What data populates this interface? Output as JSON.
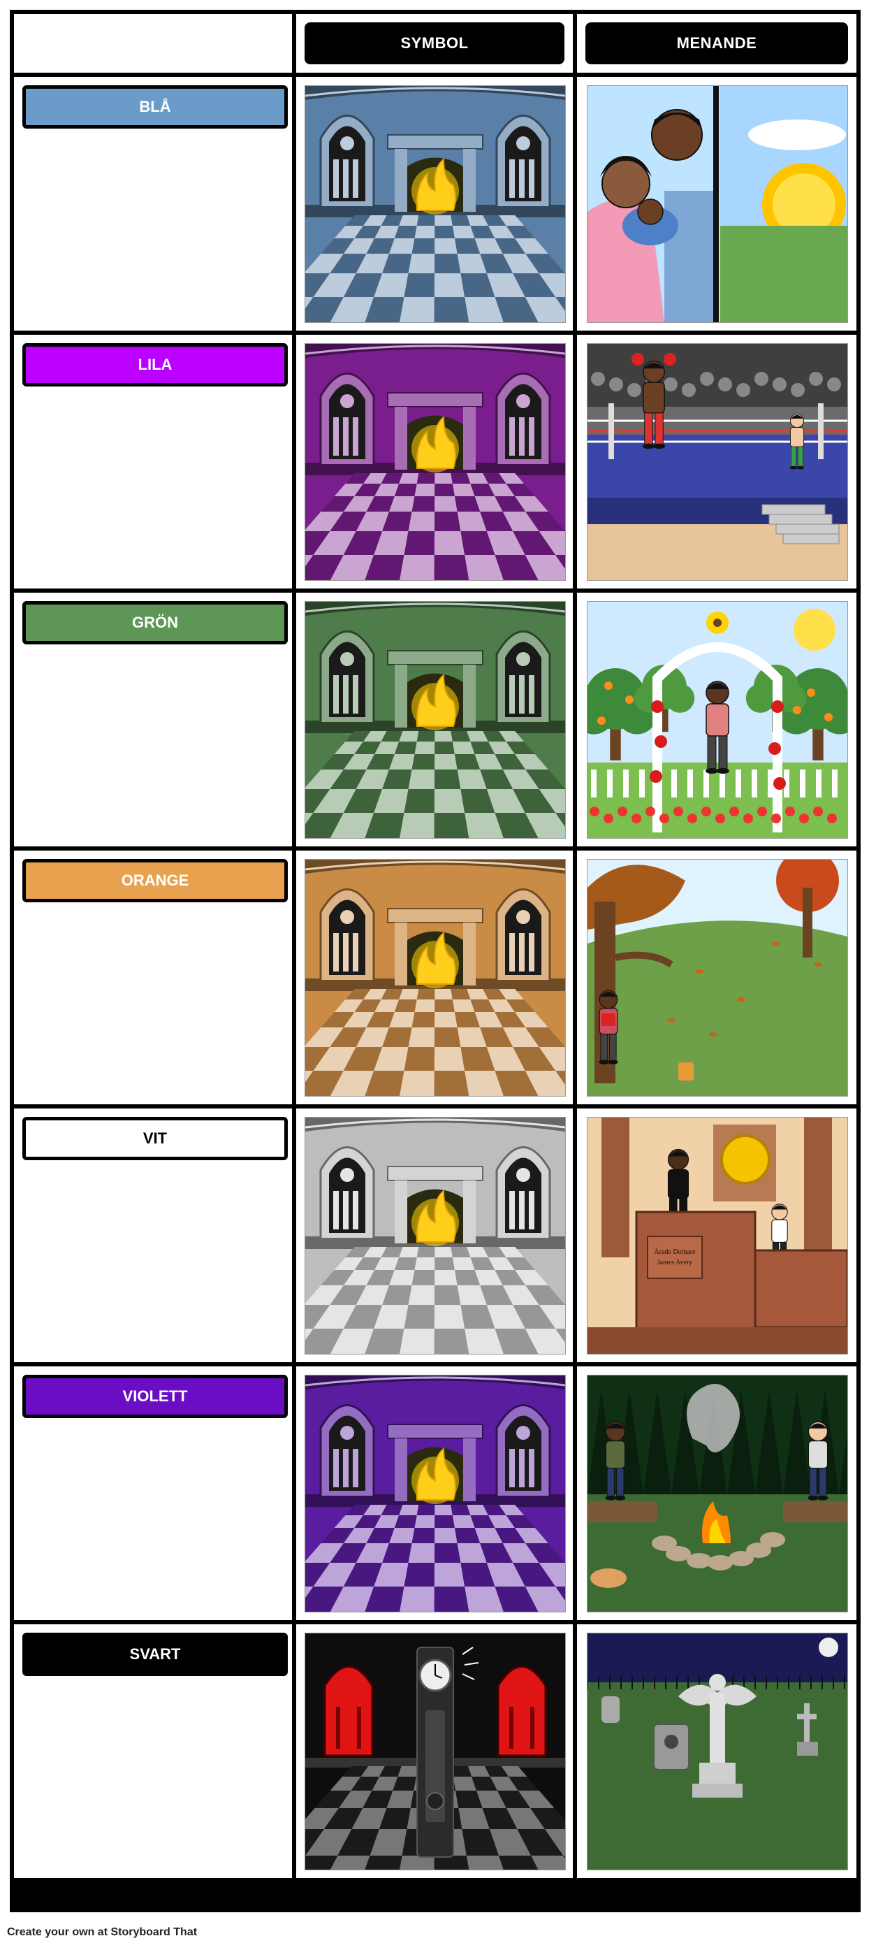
{
  "headers": {
    "symbol": "SYMBOL",
    "meaning": "MENANDE"
  },
  "rows": [
    {
      "label": "BLÅ",
      "color": "#6b9bc9",
      "text_color": "#ffffff",
      "scene_color": "#5a80a8",
      "meaning": "family-sunrise"
    },
    {
      "label": "LILA",
      "color": "#bb00ff",
      "text_color": "#ffffff",
      "scene_color": "#7a1e8e",
      "meaning": "boxing-ring"
    },
    {
      "label": "GRÖN",
      "color": "#5e9657",
      "text_color": "#ffffff",
      "scene_color": "#4e7c4a",
      "meaning": "garden-arch"
    },
    {
      "label": "ORANGE",
      "color": "#e8a24f",
      "text_color": "#ffffff",
      "scene_color": "#c98b45",
      "meaning": "autumn-reading"
    },
    {
      "label": "VIT",
      "color": "#ffffff",
      "text_color": "#000000",
      "scene_color": "#bdbdbd",
      "meaning": "courtroom"
    },
    {
      "label": "VIOLETT",
      "color": "#6a0dc4",
      "text_color": "#ffffff",
      "scene_color": "#5a1da0",
      "meaning": "campfire"
    },
    {
      "label": "SVART",
      "color": "#000000",
      "text_color": "#ffffff",
      "scene_color": "#1c1c1c",
      "meaning": "graveyard"
    }
  ],
  "judge_plaque": {
    "line1": "Ärade Domare",
    "line2": "James Avery"
  },
  "footer": "Create your own at Storyboard That"
}
